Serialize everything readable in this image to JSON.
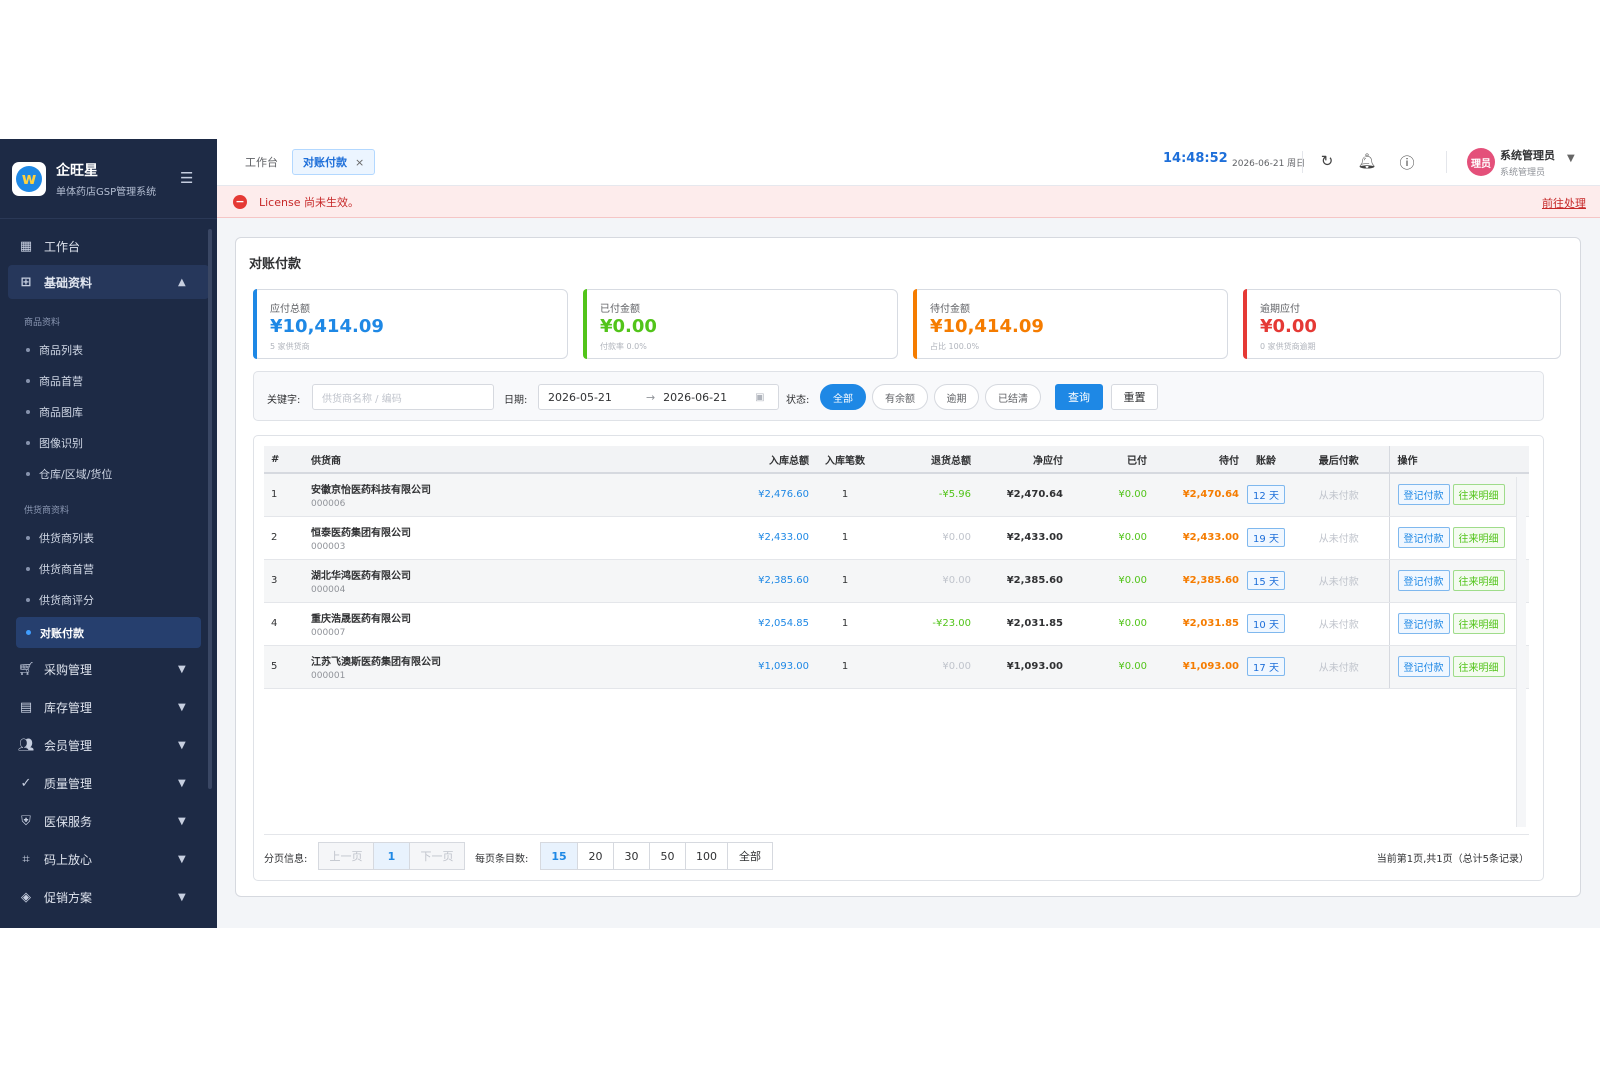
{
  "brand": {
    "name": "企旺星",
    "subtitle": "单体药店GSP管理系统"
  },
  "sidebar": {
    "workbench": "工作台",
    "basic": "基础资料",
    "group_goods": "商品资料",
    "goods_items": [
      "商品列表",
      "商品首营",
      "商品图库",
      "图像识别",
      "仓库/区域/货位"
    ],
    "group_supplier": "供货商资料",
    "supplier_items": [
      "供货商列表",
      "供货商首营",
      "供货商评分",
      "对账付款"
    ],
    "sections": [
      "采购管理",
      "库存管理",
      "会员管理",
      "质量管理",
      "医保服务",
      "码上放心",
      "促销方案"
    ]
  },
  "topbar": {
    "tab_home": "工作台",
    "tab_active": "对账付款",
    "tab_close": "×",
    "time": "14:48:52",
    "date": "2026-06-21 周日",
    "avatar_text": "理员",
    "user_name": "系统管理员",
    "user_role": "系统管理员"
  },
  "alert": {
    "text": "License 尚未生效。",
    "link": "前往处理"
  },
  "page": {
    "title": "对账付款"
  },
  "stats": [
    {
      "label": "应付总额",
      "value": "¥10,414.09",
      "sub": "5 家供货商",
      "color": "#1e88e5"
    },
    {
      "label": "已付金额",
      "value": "¥0.00",
      "sub": "付款率 0.0%",
      "color": "#52c41a"
    },
    {
      "label": "待付金额",
      "value": "¥10,414.09",
      "sub": "占比 100.0%",
      "color": "#f57c00"
    },
    {
      "label": "逾期应付",
      "value": "¥0.00",
      "sub": "0 家供货商逾期",
      "color": "#e53935"
    }
  ],
  "filter": {
    "keyword_label": "关键字:",
    "keyword_placeholder": "供货商名称 / 编码",
    "date_label": "日期:",
    "date_from": "2026-05-21",
    "date_arrow": "→",
    "date_to": "2026-06-21",
    "status_label": "状态:",
    "status_options": [
      "全部",
      "有余额",
      "逾期",
      "已结清"
    ],
    "query": "查询",
    "reset": "重置"
  },
  "table": {
    "headers": [
      "#",
      "供货商",
      "入库总额",
      "入库笔数",
      "退货总额",
      "净应付",
      "已付",
      "待付",
      "账龄",
      "最后付款",
      "操作"
    ],
    "rows": [
      {
        "no": "1",
        "name": "安徽京怡医药科技有限公司",
        "code": "000006",
        "in_total": "¥2,476.60",
        "in_count": "1",
        "return_total": "-¥5.96",
        "net": "¥2,470.64",
        "paid": "¥0.00",
        "pending": "¥2,470.64",
        "age": "12 天",
        "last_pay": "从未付款",
        "op1": "登记付款",
        "op2": "往来明细"
      },
      {
        "no": "2",
        "name": "恒泰医药集团有限公司",
        "code": "000003",
        "in_total": "¥2,433.00",
        "in_count": "1",
        "return_total": "¥0.00",
        "net": "¥2,433.00",
        "paid": "¥0.00",
        "pending": "¥2,433.00",
        "age": "19 天",
        "last_pay": "从未付款",
        "op1": "登记付款",
        "op2": "往来明细"
      },
      {
        "no": "3",
        "name": "湖北华鸿医药有限公司",
        "code": "000004",
        "in_total": "¥2,385.60",
        "in_count": "1",
        "return_total": "¥0.00",
        "net": "¥2,385.60",
        "paid": "¥0.00",
        "pending": "¥2,385.60",
        "age": "15 天",
        "last_pay": "从未付款",
        "op1": "登记付款",
        "op2": "往来明细"
      },
      {
        "no": "4",
        "name": "重庆浩晟医药有限公司",
        "code": "000007",
        "in_total": "¥2,054.85",
        "in_count": "1",
        "return_total": "-¥23.00",
        "net": "¥2,031.85",
        "paid": "¥0.00",
        "pending": "¥2,031.85",
        "age": "10 天",
        "last_pay": "从未付款",
        "op1": "登记付款",
        "op2": "往来明细"
      },
      {
        "no": "5",
        "name": "江苏飞澳斯医药集团有限公司",
        "code": "000001",
        "in_total": "¥1,093.00",
        "in_count": "1",
        "return_total": "¥0.00",
        "net": "¥1,093.00",
        "paid": "¥0.00",
        "pending": "¥1,093.00",
        "age": "17 天",
        "last_pay": "从未付款",
        "op1": "登记付款",
        "op2": "往来明细"
      }
    ]
  },
  "pager": {
    "info_label": "分页信息:",
    "prev": "上一页",
    "current": "1",
    "next": "下一页",
    "size_label": "每页条目数:",
    "sizes": [
      "15",
      "20",
      "30",
      "50",
      "100",
      "全部"
    ],
    "summary": "当前第1页,共1页（总计5条记录）"
  }
}
